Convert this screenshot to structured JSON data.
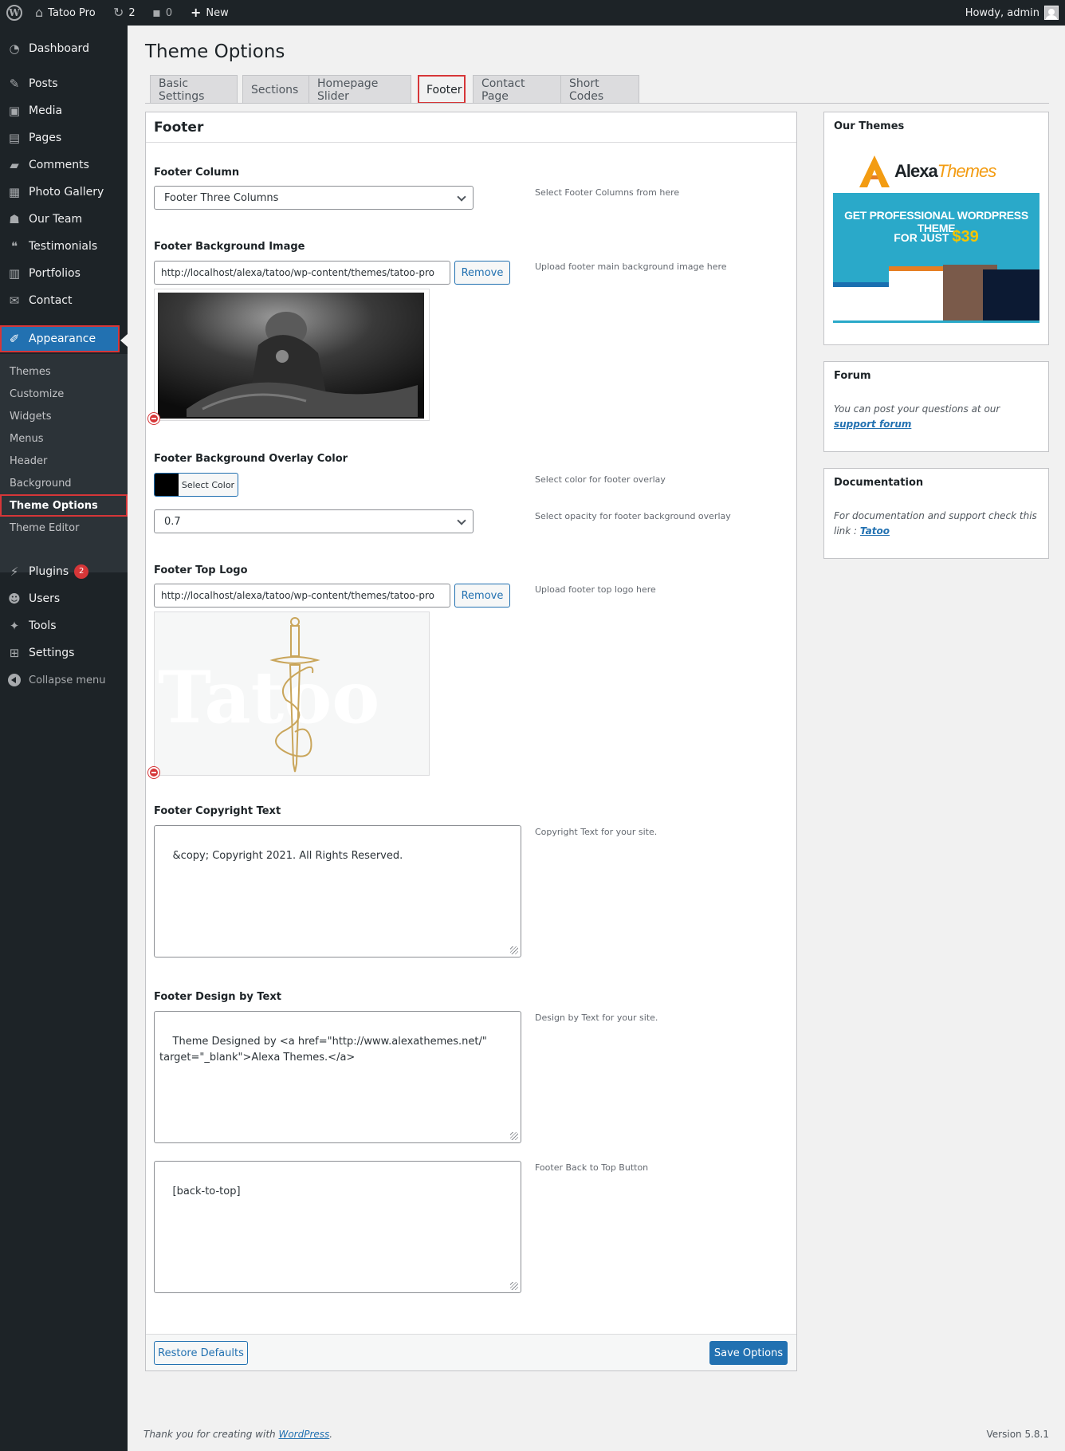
{
  "admin_bar": {
    "site_name": "Tatoo Pro",
    "updates_count": "2",
    "comments_count": "0",
    "new_label": "New",
    "howdy": "Howdy, admin"
  },
  "sidebar": {
    "items": [
      {
        "label": "Dashboard",
        "icon": "dashboard-icon"
      },
      {
        "label": "Posts",
        "icon": "pin-icon"
      },
      {
        "label": "Media",
        "icon": "media-icon"
      },
      {
        "label": "Pages",
        "icon": "pages-icon"
      },
      {
        "label": "Comments",
        "icon": "comment-icon"
      },
      {
        "label": "Photo Gallery",
        "icon": "gallery-icon"
      },
      {
        "label": "Our Team",
        "icon": "team-icon"
      },
      {
        "label": "Testimonials",
        "icon": "quote-icon"
      },
      {
        "label": "Portfolios",
        "icon": "portfolio-icon"
      },
      {
        "label": "Contact",
        "icon": "mail-icon"
      },
      {
        "label": "Appearance",
        "icon": "brush-icon"
      }
    ],
    "submenu": [
      "Themes",
      "Customize",
      "Widgets",
      "Menus",
      "Header",
      "Background",
      "Theme Options",
      "Theme Editor"
    ],
    "bottom_items": [
      {
        "label": "Plugins",
        "icon": "plugin-icon",
        "badge": "2"
      },
      {
        "label": "Users",
        "icon": "user-icon"
      },
      {
        "label": "Tools",
        "icon": "wrench-icon"
      },
      {
        "label": "Settings",
        "icon": "settings-icon"
      }
    ],
    "collapse_label": "Collapse menu"
  },
  "page": {
    "title": "Theme Options",
    "tabs": [
      "Basic Settings",
      "Sections",
      "Homepage Slider",
      "Footer",
      "Contact Page",
      "Short Codes"
    ],
    "active_tab": "Footer"
  },
  "panel": {
    "heading": "Footer",
    "footer_column": {
      "label": "Footer Column",
      "value": "Footer Three Columns",
      "desc": "Select Footer Columns from here"
    },
    "bg_image": {
      "label": "Footer Background Image",
      "value": "http://localhost/alexa/tatoo/wp-content/themes/tatoo-pro",
      "remove": "Remove",
      "desc": "Upload footer main background image here"
    },
    "overlay": {
      "label": "Footer Background Overlay Color",
      "select_color": "Select Color",
      "color": "#000000",
      "desc": "Select color for footer overlay",
      "opacity": "0.7",
      "opacity_desc": "Select opacity for footer background overlay"
    },
    "top_logo": {
      "label": "Footer Top Logo",
      "value": "http://localhost/alexa/tatoo/wp-content/themes/tatoo-pro",
      "remove": "Remove",
      "desc": "Upload footer top logo here",
      "watermark_text": "Tatoo"
    },
    "copyright": {
      "label": "Footer Copyright Text",
      "value": "&copy; Copyright 2021. All Rights Reserved.",
      "desc": "Copyright Text for your site."
    },
    "design_by": {
      "label": "Footer Design by Text",
      "value": "Theme Designed by <a href=\"http://www.alexathemes.net/\"\ntarget=\"_blank\">Alexa Themes.</a>",
      "desc": "Design by Text for your site."
    },
    "back_to_top": {
      "value": "[back-to-top]",
      "desc": "Footer Back to Top Button"
    },
    "restore_label": "Restore Defaults",
    "save_label": "Save Options"
  },
  "widgets": {
    "themes": {
      "title": "Our Themes",
      "brand": "AlexaThemes",
      "brand_a": "Alexa",
      "brand_b": "Themes",
      "promo_line1": "GET PROFESSIONAL WORDPRESS THEME",
      "promo_line2": "FOR JUST",
      "promo_price": "$39"
    },
    "forum": {
      "title": "Forum",
      "text": "You can post your questions at our",
      "link": "support forum"
    },
    "docs": {
      "title": "Documentation",
      "text": "For documentation and support check this link :",
      "link": "Tatoo"
    }
  },
  "footer": {
    "thanks_text": "Thank you for creating with",
    "thanks_link": "WordPress",
    "version": "Version 5.8.1"
  },
  "colors": {
    "admin_dark": "#1d2327",
    "accent": "#2271b1",
    "highlight": "#d63638",
    "promo_bg": "#2aa9c9",
    "promo_price": "#f5c400"
  }
}
